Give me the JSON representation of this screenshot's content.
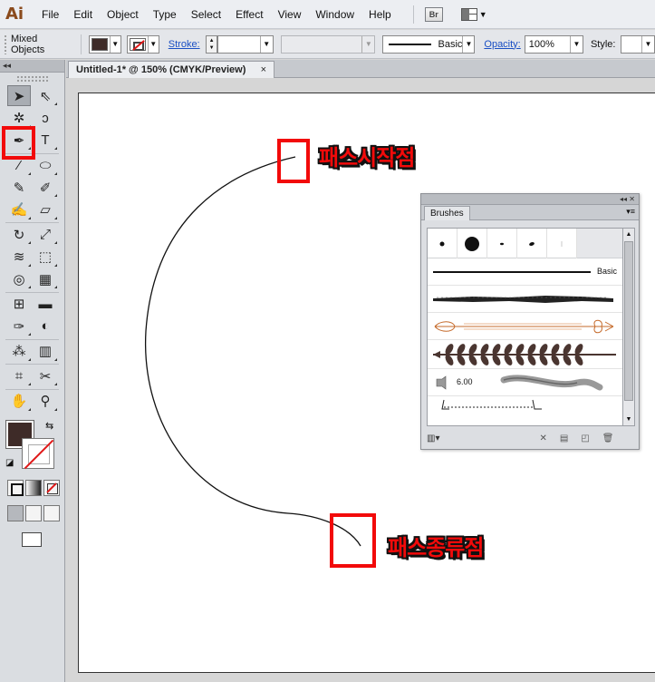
{
  "app": {
    "logo": "Ai"
  },
  "menu": {
    "items": [
      "File",
      "Edit",
      "Object",
      "Type",
      "Select",
      "Effect",
      "View",
      "Window",
      "Help"
    ],
    "bridge_badge": "Br"
  },
  "control_bar": {
    "selection_label": "Mixed Objects",
    "stroke_label": "Stroke:",
    "stroke_weight": "",
    "brush_label": "Basic",
    "opacity_label": "Opacity:",
    "opacity_value": "100%",
    "style_label": "Style:"
  },
  "document": {
    "tab_title": "Untitled-1* @ 150% (CMYK/Preview)",
    "close_glyph": "×"
  },
  "tools": {
    "panel_collapse_glyph": "◂◂",
    "rows": [
      [
        "selection-tool",
        "direct-selection-tool"
      ],
      [
        "magic-wand-tool",
        "lasso-tool"
      ],
      [
        "pen-tool",
        "type-tool"
      ],
      [
        "line-segment-tool",
        "ellipse-tool"
      ],
      [
        "paintbrush-tool",
        "pencil-tool"
      ],
      [
        "blob-brush-tool",
        "eraser-tool"
      ],
      [
        "rotate-tool",
        "scale-tool"
      ],
      [
        "warp-tool",
        "free-transform-tool"
      ],
      [
        "shape-builder-tool",
        "perspective-grid-tool"
      ],
      [
        "mesh-tool",
        "gradient-tool"
      ],
      [
        "eyedropper-tool",
        "blend-tool"
      ],
      [
        "symbol-sprayer-tool",
        "column-graph-tool"
      ],
      [
        "artboard-tool",
        "slice-tool"
      ],
      [
        "hand-tool",
        "zoom-tool"
      ]
    ],
    "glyphs": {
      "selection-tool": "➤",
      "direct-selection-tool": "⇖",
      "magic-wand-tool": "✲",
      "lasso-tool": "ↄ",
      "pen-tool": "✒",
      "type-tool": "T",
      "line-segment-tool": "⁄",
      "ellipse-tool": "⬭",
      "paintbrush-tool": "✎",
      "pencil-tool": "✐",
      "blob-brush-tool": "✍",
      "eraser-tool": "▱",
      "rotate-tool": "↻",
      "scale-tool": "⤢",
      "warp-tool": "≋",
      "free-transform-tool": "⬚",
      "shape-builder-tool": "◎",
      "perspective-grid-tool": "▦",
      "mesh-tool": "⊞",
      "gradient-tool": "▬",
      "eyedropper-tool": "✑",
      "blend-tool": "◐",
      "symbol-sprayer-tool": "⁂",
      "column-graph-tool": "▥",
      "artboard-tool": "⌗",
      "slice-tool": "✂",
      "hand-tool": "✋",
      "zoom-tool": "⚲"
    },
    "fill_color": "#3e2b28"
  },
  "brushes_panel": {
    "tab_label": "Brushes",
    "collapse_glyph": "◂◂ ✕",
    "menu_glyph": "▾≡",
    "basic_label": "Basic",
    "bristle_size": "6.00",
    "art_brush_color": "#c56a2a",
    "pattern_color": "#4a3530"
  },
  "annotations": {
    "path_start": "패스시작점",
    "path_end": "패스종류점",
    "highlight_color": "#f20a0a"
  },
  "colors": {
    "link": "#1a4fc4",
    "stroke_none_red": "#e01818"
  }
}
